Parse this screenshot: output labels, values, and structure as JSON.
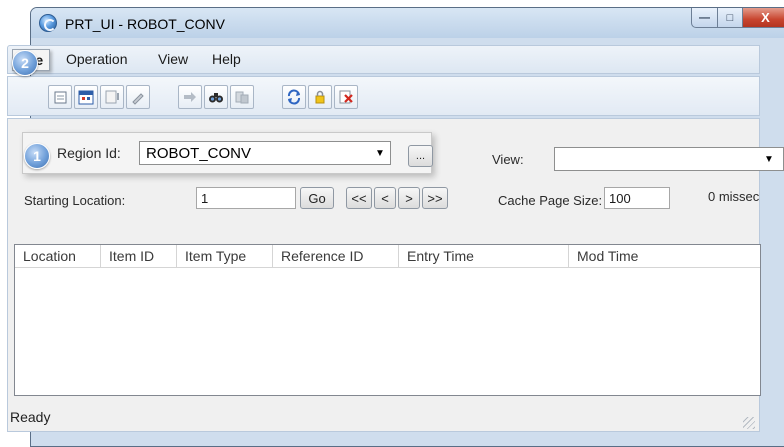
{
  "window": {
    "title": "PRT_UI - ROBOT_CONV",
    "controls": {
      "minimize": "—",
      "maximize": "□",
      "close": "X"
    }
  },
  "menu": {
    "items": [
      {
        "label": "File"
      },
      {
        "label": "Operation"
      },
      {
        "label": "View"
      },
      {
        "label": "Help"
      }
    ]
  },
  "toolbar": {
    "buttons": [
      "new-icon",
      "calendar-icon",
      "properties-icon",
      "edit-icon",
      "arrow-right-icon",
      "find-icon",
      "filter-icon",
      "refresh-icon",
      "lock-icon",
      "delete-icon"
    ]
  },
  "callouts": {
    "one": "1",
    "two": "2"
  },
  "region": {
    "label": "Region Id:",
    "value": "ROBOT_CONV",
    "browse_label": "..."
  },
  "view": {
    "label": "View:",
    "value": ""
  },
  "navigation": {
    "starting_location_label": "Starting Location:",
    "starting_location_value": "1",
    "go_label": "Go",
    "first_label": "<<",
    "prev_label": "<",
    "next_label": ">",
    "last_label": ">>",
    "cache_label": "Cache Page Size:",
    "cache_value": "100",
    "missed_text": "0 missec"
  },
  "table": {
    "columns": [
      "Location",
      "Item ID",
      "Item Type",
      "Reference ID",
      "Entry Time",
      "Mod Time"
    ],
    "rows": []
  },
  "status": {
    "text": "Ready"
  }
}
